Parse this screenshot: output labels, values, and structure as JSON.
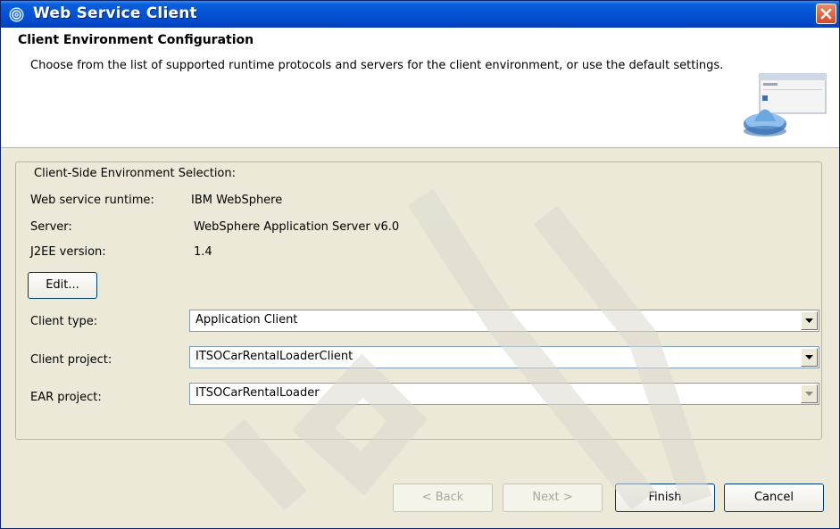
{
  "window": {
    "title": "Web Service Client",
    "icon": "web-service-icon",
    "close_icon": "close-icon"
  },
  "banner": {
    "title": "Client Environment Configuration",
    "description": "Choose from the list of supported runtime protocols and servers for the client environment, or use the default settings.",
    "graphic_icon": "wizard-banner-icon"
  },
  "group": {
    "legend": "Client-Side Environment Selection:",
    "runtime_label": "Web service runtime:",
    "runtime_value": "IBM WebSphere",
    "server_label": "Server:",
    "server_value": "WebSphere Application Server v6.0",
    "j2ee_label": "J2EE version:",
    "j2ee_value": "1.4",
    "edit_button": "Edit...",
    "client_type_label": "Client type:",
    "client_type_value": "Application Client",
    "client_project_label": "Client project:",
    "client_project_value": "ITSOCarRentalLoaderClient",
    "ear_project_label": "EAR project:",
    "ear_project_value": "ITSOCarRentalLoader"
  },
  "buttons": {
    "back": "< Back",
    "next": "Next >",
    "finish": "Finish",
    "cancel": "Cancel"
  },
  "colors": {
    "titlebar": "#0453d4",
    "dialog_bg": "#ece9d8",
    "watermark": "#e6e4d8"
  }
}
